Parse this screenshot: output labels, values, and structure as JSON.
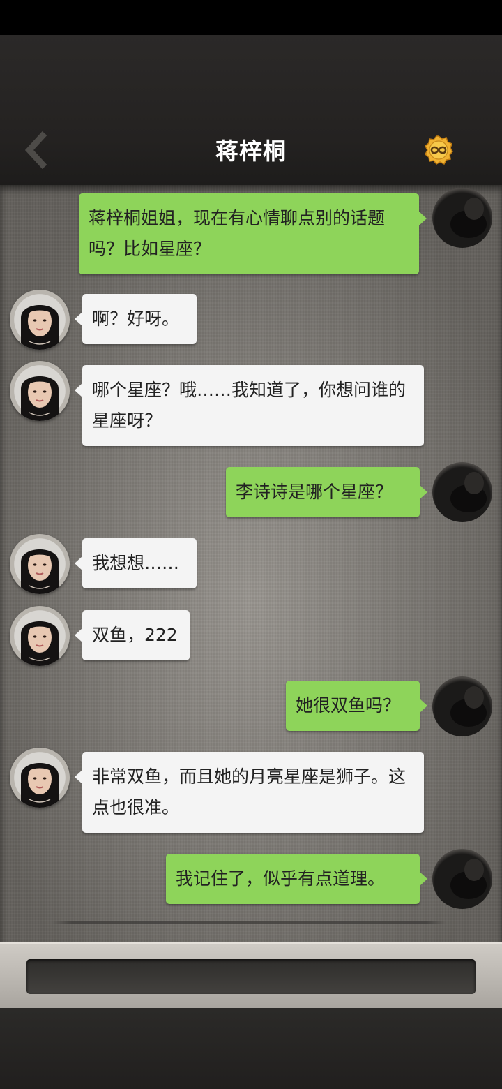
{
  "header": {
    "title": "蒋梓桐",
    "back_icon": "chevron-left-icon",
    "coin_icon": "infinity-coin-icon",
    "coin_color": "#e9a52a"
  },
  "colors": {
    "sent_bubble": "#8ed45a",
    "received_bubble": "#f4f4f4",
    "chat_bg": "#8c8882"
  },
  "messages": [
    {
      "side": "right",
      "text": "蒋梓桐姐姐，现在有心情聊点别的话题吗？比如星座？"
    },
    {
      "side": "left",
      "text": "啊？好呀。"
    },
    {
      "side": "left",
      "text": "哪个星座？哦……我知道了，你想问谁的星座呀？"
    },
    {
      "side": "right",
      "text": "李诗诗是哪个星座？"
    },
    {
      "side": "left",
      "text": "我想想……"
    },
    {
      "side": "left",
      "text": "双鱼，222"
    },
    {
      "side": "right",
      "text": "她很双鱼吗？"
    },
    {
      "side": "left",
      "text": "非常双鱼，而且她的月亮星座是狮子。这点也很准。"
    },
    {
      "side": "right",
      "text": "我记住了，似乎有点道理。"
    }
  ],
  "input": {
    "value": ""
  }
}
